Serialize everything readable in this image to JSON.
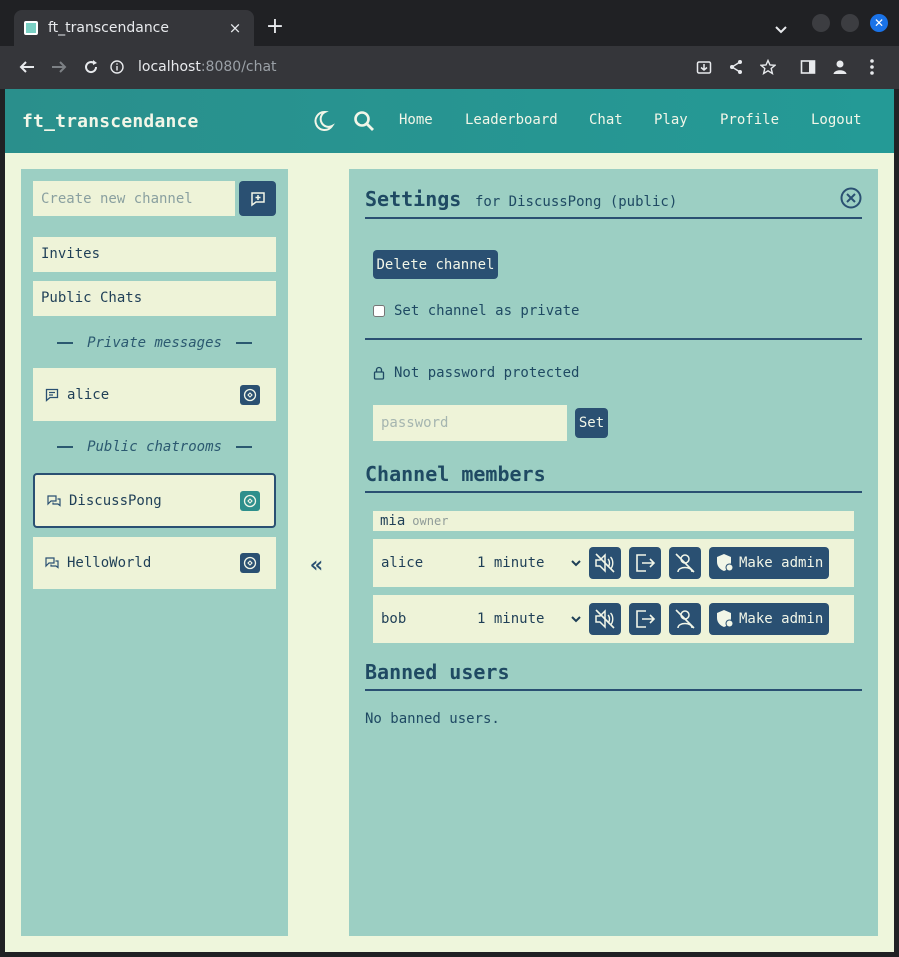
{
  "browser": {
    "tab_title": "ft_transcendance",
    "tab_close": "×",
    "new_tab": "+",
    "url_host": "localhost",
    "url_path": ":8080/chat"
  },
  "navbar": {
    "brand": "ft_transcendance",
    "links": [
      "Home",
      "Leaderboard",
      "Chat",
      "Play",
      "Profile",
      "Logout"
    ]
  },
  "sidebar": {
    "new_channel_placeholder": "Create new channel",
    "invites": "Invites",
    "public_chats": "Public Chats",
    "private_messages_title": "Private messages",
    "private_messages": [
      {
        "name": "alice"
      }
    ],
    "public_chatrooms_title": "Public chatrooms",
    "public_chatrooms": [
      {
        "name": "DiscussPong",
        "active": true
      },
      {
        "name": "HelloWorld",
        "active": false
      }
    ],
    "collapse": "«"
  },
  "settings": {
    "title": "Settings",
    "subtitle": "for DiscussPong (public)",
    "delete_channel": "Delete channel",
    "set_private_label": "Set channel as private",
    "set_private_checked": false,
    "password_status": "Not password protected",
    "password_placeholder": "password",
    "set_button": "Set",
    "members_title": "Channel members",
    "owner": {
      "name": "mia",
      "role": "owner"
    },
    "members": [
      {
        "name": "alice",
        "duration": "1 minute",
        "make_admin": "Make admin"
      },
      {
        "name": "bob",
        "duration": "1 minute",
        "make_admin": "Make admin"
      }
    ],
    "banned_title": "Banned users",
    "banned_empty": "No banned users."
  },
  "colors": {
    "accent": "#2a5072",
    "navbar": "#249a96",
    "panel": "#9ccfc3",
    "page_bg": "#eef6dc"
  }
}
